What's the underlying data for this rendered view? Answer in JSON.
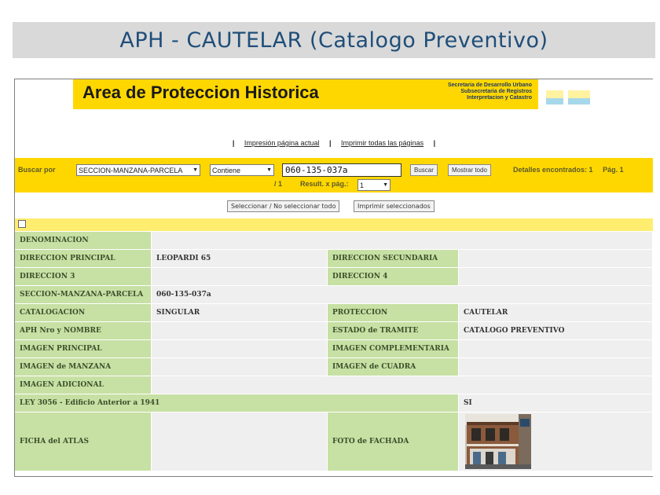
{
  "slide_title": "APH - CAUTELAR (Catalogo Preventivo)",
  "banner": {
    "title": "Area de Proteccion Historica",
    "secretaria": [
      "Secretaria de Desarrollo Urbano",
      "Subsecretaria de Registros",
      "Interpretacion y Catastro"
    ]
  },
  "print_links": {
    "current": "Impresión página actual",
    "all": "Imprimir todas las páginas"
  },
  "search": {
    "label": "Buscar por",
    "field": "SECCION-MANZANA-PARCELA",
    "operator": "Contiene",
    "value": "060-135-037a",
    "buscar": "Buscar",
    "mostrar": "Mostrar todo",
    "found_label": "Detalles encontrados:",
    "found_count": "1",
    "page_label": "Pág. 1",
    "page_total": "/ 1",
    "per_page_label": "Result. x pág.:",
    "per_page_value": "1"
  },
  "actions": {
    "select_all": "Seleccionar / No seleccionar todo",
    "print_selected": "Imprimir seleccionados"
  },
  "record": {
    "denominacion_label": "DENOMINACION",
    "denominacion": "",
    "dir_principal_label": "DIRECCION PRINCIPAL",
    "dir_principal": "LEOPARDI 65",
    "dir_secundaria_label": "DIRECCION SECUNDARIA",
    "dir_secundaria": "",
    "dir3_label": "DIRECCION 3",
    "dir3": "",
    "dir4_label": "DIRECCION 4",
    "dir4": "",
    "smp_label": "SECCION-MANZANA-PARCELA",
    "smp": "060-135-037a",
    "catalogacion_label": "CATALOGACION",
    "catalogacion": "SINGULAR",
    "proteccion_label": "PROTECCION",
    "proteccion": "CAUTELAR",
    "aph_label": "APH Nro y NOMBRE",
    "aph": "",
    "estado_label": "ESTADO de TRAMITE",
    "estado": "CATALOGO PREVENTIVO",
    "img_principal_label": "IMAGEN PRINCIPAL",
    "img_principal": "",
    "img_complementaria_label": "IMAGEN COMPLEMENTARIA",
    "img_complementaria": "",
    "img_manzana_label": "IMAGEN de MANZANA",
    "img_manzana": "",
    "img_cuadra_label": "IMAGEN de CUADRA",
    "img_cuadra": "",
    "img_adicional_label": "IMAGEN ADICIONAL",
    "img_adicional": "",
    "ley_label": "LEY 3056 - Edificio Anterior a 1941",
    "ley": "SI",
    "ficha_label": "FICHA del ATLAS",
    "ficha": "",
    "foto_label": "FOTO de FACHADA"
  },
  "colors": {
    "yellow": "#ffd700",
    "label_green": "#c7e0a4",
    "value_gray": "#efefef",
    "title_blue": "#1f4e79"
  }
}
